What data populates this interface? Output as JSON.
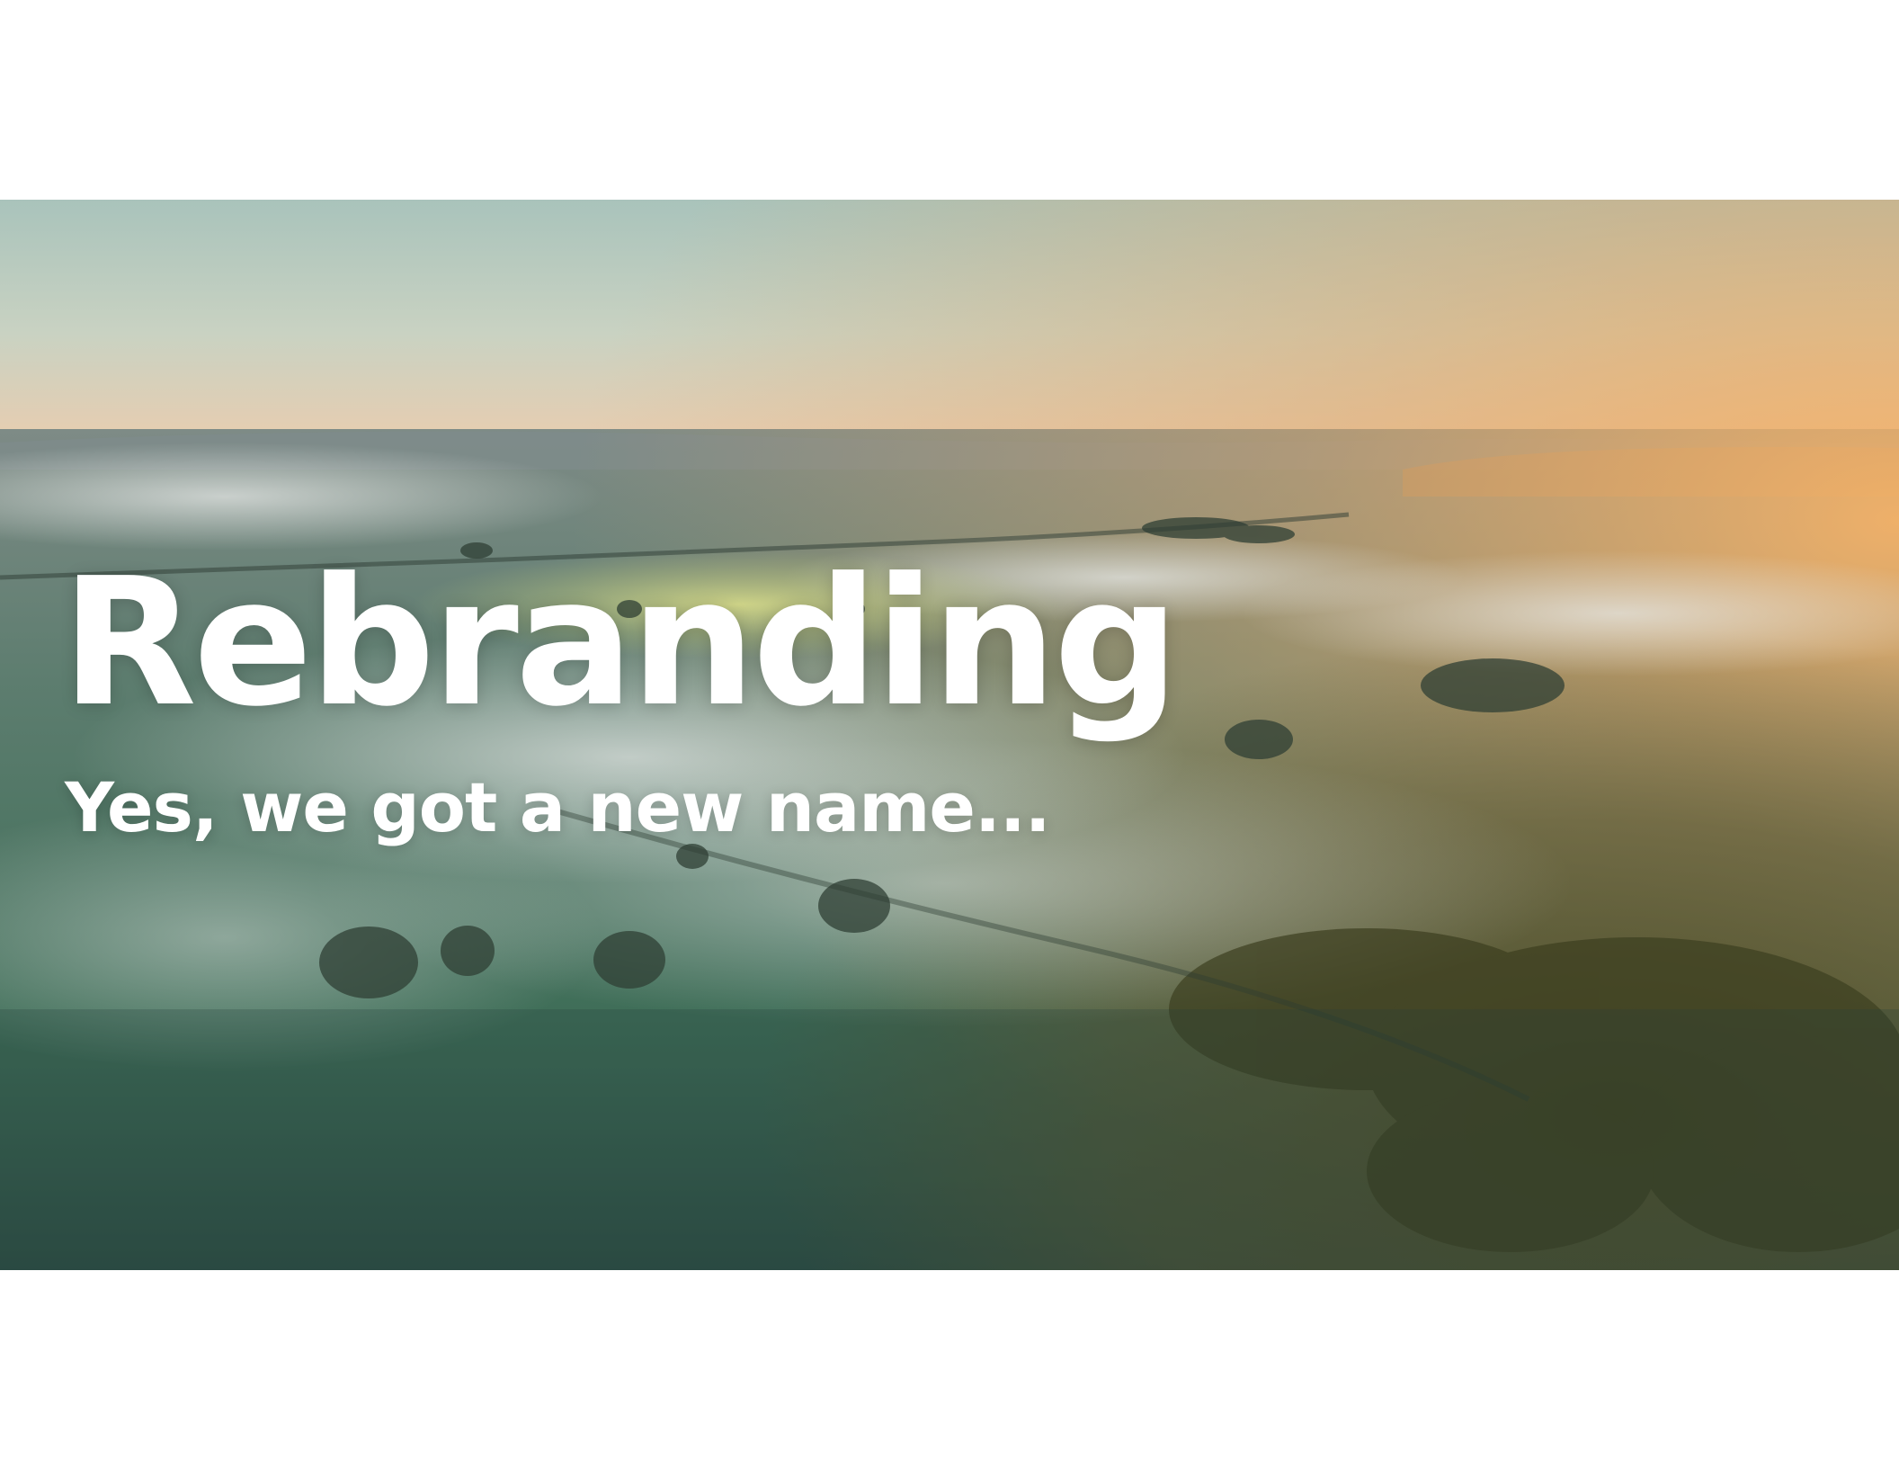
{
  "slide": {
    "title": "Rebranding",
    "subtitle": "Yes, we got a new name..."
  },
  "background": {
    "icon": "misty-landscape-photo",
    "colors": {
      "sky_top": "#a9c3bb",
      "sky_horizon": "#e8cdb0",
      "sun_glow": "#f0a860",
      "field_green": "#3f6e58",
      "field_dark": "#2d4d44",
      "forest": "#5a5530",
      "mist": "#dfe3e2"
    }
  }
}
